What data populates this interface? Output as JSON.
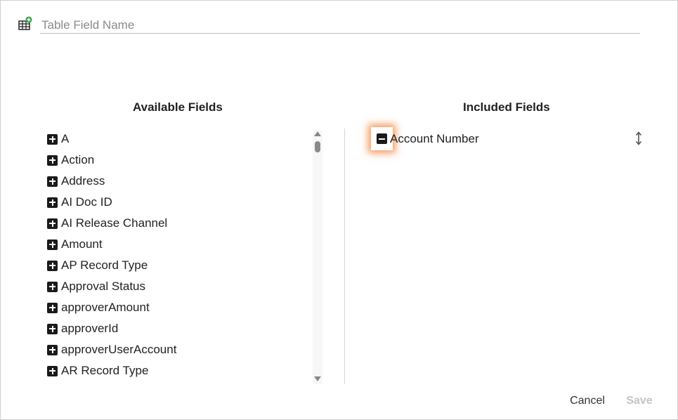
{
  "table_field": {
    "placeholder": "Table Field Name",
    "value": "",
    "icon": "table-add-icon"
  },
  "available": {
    "title": "Available Fields",
    "add_icon": "plus-square-icon",
    "items": [
      "A",
      "Action",
      "Address",
      "AI Doc ID",
      "AI Release Channel",
      "Amount",
      "AP Record Type",
      "Approval Status",
      "approverAmount",
      "approverId",
      "approverUserAccount",
      "AR Record Type"
    ]
  },
  "included": {
    "title": "Included Fields",
    "remove_icon": "minus-square-icon",
    "drag_icon": "vertical-resize-icon",
    "items": [
      "Account Number"
    ]
  },
  "footer": {
    "cancel_label": "Cancel",
    "save_label": "Save"
  },
  "colors": {
    "highlight": "#f07828",
    "disabled_text": "#c4c4c4",
    "icon_dark": "#1a1a1a",
    "icon_green": "#3aa24a"
  }
}
